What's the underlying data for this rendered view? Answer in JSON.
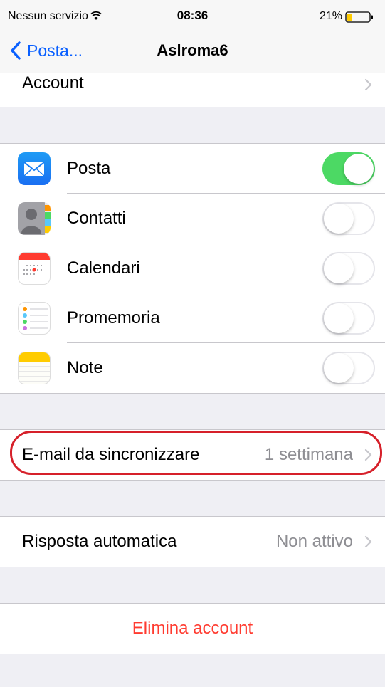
{
  "status": {
    "carrier": "Nessun servizio",
    "time": "08:36",
    "battery": "21%"
  },
  "nav": {
    "back_label": "Posta...",
    "title": "Aslroma6"
  },
  "account_row": {
    "label": "Account"
  },
  "services": [
    {
      "label": "Posta",
      "icon": "mail-icon",
      "enabled": true
    },
    {
      "label": "Contatti",
      "icon": "contacts-icon",
      "enabled": false
    },
    {
      "label": "Calendari",
      "icon": "calendar-icon",
      "enabled": false
    },
    {
      "label": "Promemoria",
      "icon": "reminders-icon",
      "enabled": false
    },
    {
      "label": "Note",
      "icon": "notes-icon",
      "enabled": false
    }
  ],
  "mail_sync": {
    "label": "E-mail da sincronizzare",
    "value": "1 settimana"
  },
  "auto_reply": {
    "label": "Risposta automatica",
    "value": "Non attivo"
  },
  "delete_account": {
    "label": "Elimina account"
  },
  "colors": {
    "accent": "#0a60ff",
    "toggle_on": "#4cd964",
    "destructive": "#ff3b30",
    "highlight": "#d6202a",
    "background": "#efeff4"
  }
}
